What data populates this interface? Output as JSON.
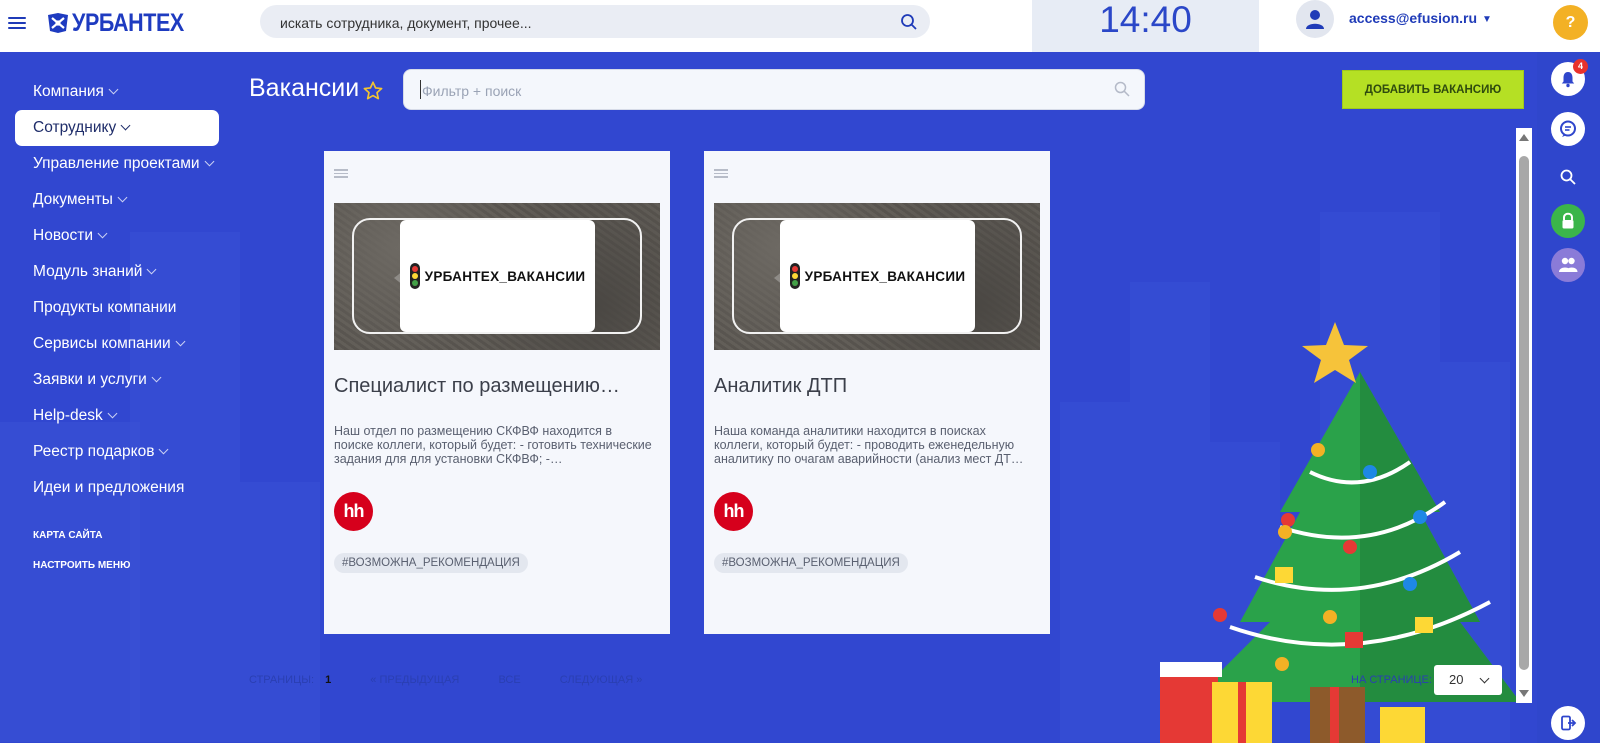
{
  "header": {
    "logo_text": "УРБАНТЕХ",
    "search_placeholder": "искать сотрудника, документ, прочее...",
    "clock": "14:40",
    "user_email": "access@efusion.ru",
    "help_label": "?",
    "icons": [
      "menu-icon",
      "search-icon",
      "user-icon",
      "chevron-down-icon"
    ]
  },
  "sidebar": {
    "items": [
      {
        "label": "Компания",
        "has_submenu": true
      },
      {
        "label": "Сотруднику",
        "has_submenu": true,
        "active": true
      },
      {
        "label": "Управление проектами",
        "has_submenu": true
      },
      {
        "label": "Документы",
        "has_submenu": true
      },
      {
        "label": "Новости",
        "has_submenu": true
      },
      {
        "label": "Модуль знаний",
        "has_submenu": true
      },
      {
        "label": "Продукты компании",
        "has_submenu": false
      },
      {
        "label": "Сервисы компании",
        "has_submenu": true
      },
      {
        "label": "Заявки и услуги",
        "has_submenu": true
      },
      {
        "label": "Help-desk",
        "has_submenu": true
      },
      {
        "label": "Реестр подарков",
        "has_submenu": true
      },
      {
        "label": "Идеи и предложения",
        "has_submenu": false
      }
    ],
    "sitemap": "КАРТА САЙТА",
    "configure_menu": "НАСТРОИТЬ МЕНЮ"
  },
  "page": {
    "title": "Вакансии",
    "filter_placeholder": "Фильтр + поиск",
    "add_button": "ДОБАВИТЬ ВАКАНСИЮ"
  },
  "vacancies": [
    {
      "banner_text": "УРБАНТЕХ_ВАКАНСИИ",
      "title": "Специалист по размещению…",
      "description": "Наш отдел по размещению СКФВФ находится в поиске коллеги, который будет: - готовить технические задания для для установки СКФВФ; -…",
      "source_logo": "hh",
      "tag": "#ВОЗМОЖНА_РЕКОМЕНДАЦИЯ"
    },
    {
      "banner_text": "УРБАНТЕХ_ВАКАНСИИ",
      "title": "Аналитик ДТП",
      "description": "Наша команда аналитики находится в поисках коллеги, который будет: - проводить еженедельную аналитику по очагам аварийности (анализ мест ДТ…",
      "source_logo": "hh",
      "tag": "#ВОЗМОЖНА_РЕКОМЕНДАЦИЯ"
    }
  ],
  "pagination": {
    "pages_label": "СТРАНИЦЫ:",
    "current_page": "1",
    "prev_label": "« ПРЕДЫДУЩАЯ",
    "all_label": "ВСЕ",
    "next_label": "СЛЕДУЮЩАЯ »",
    "per_page_label": "НА СТРАНИЦЕ:",
    "per_page_value": "20"
  },
  "rail": {
    "notifications_count": "4",
    "icons": [
      "bell-icon",
      "chat-icon",
      "search-icon",
      "lock-icon",
      "users-icon",
      "logout-icon"
    ]
  },
  "colors": {
    "brand_blue": "#3147d0",
    "accent_green": "#b5e024",
    "hh_red": "#d6001c",
    "help_yellow": "#f3b125"
  }
}
